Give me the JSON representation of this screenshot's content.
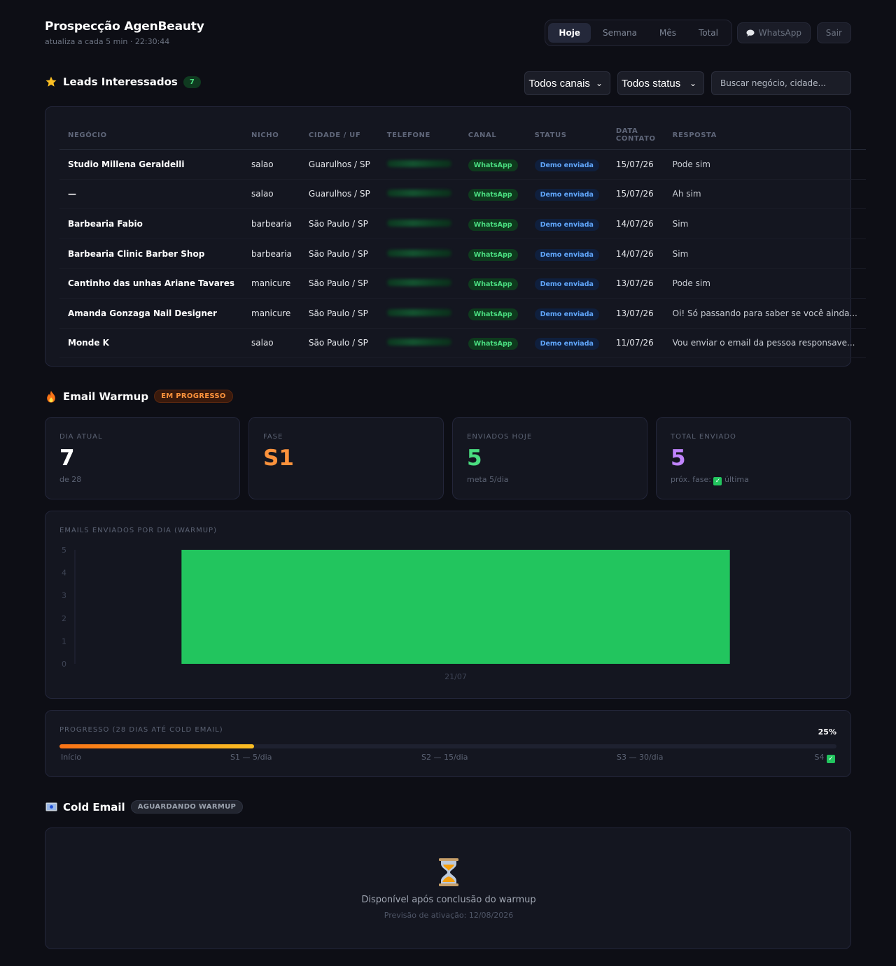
{
  "header": {
    "title": "Prospecção AgenBeauty",
    "subtitle": "atualiza a cada 5 min · 22:30:44",
    "periods": [
      "Hoje",
      "Semana",
      "Mês",
      "Total"
    ],
    "active_period": "Hoje",
    "whatsapp_label": "WhatsApp",
    "logout_label": "Sair"
  },
  "leads": {
    "title": "Leads Interessados",
    "count": "7",
    "filters": {
      "channel": "Todos canais",
      "status": "Todos status",
      "search_placeholder": "Buscar negócio, cidade..."
    },
    "columns": [
      "NEGÓCIO",
      "NICHO",
      "CIDADE / UF",
      "TELEFONE",
      "CANAL",
      "STATUS",
      "DATA CONTATO",
      "RESPOSTA"
    ],
    "rows": [
      {
        "negocio": "Studio Millena Geraldelli",
        "nicho": "salao",
        "cidade": "Guarulhos / SP",
        "canal": "WhatsApp",
        "status": "Demo enviada",
        "data": "15/07/26",
        "resposta": "Pode sim"
      },
      {
        "negocio": "—",
        "nicho": "salao",
        "cidade": "Guarulhos / SP",
        "canal": "WhatsApp",
        "status": "Demo enviada",
        "data": "15/07/26",
        "resposta": "Ah sim"
      },
      {
        "negocio": "Barbearia Fabio",
        "nicho": "barbearia",
        "cidade": "São Paulo / SP",
        "canal": "WhatsApp",
        "status": "Demo enviada",
        "data": "14/07/26",
        "resposta": "Sim"
      },
      {
        "negocio": "Barbearia Clinic Barber Shop",
        "nicho": "barbearia",
        "cidade": "São Paulo / SP",
        "canal": "WhatsApp",
        "status": "Demo enviada",
        "data": "14/07/26",
        "resposta": "Sim"
      },
      {
        "negocio": "Cantinho das unhas Ariane Tavares",
        "nicho": "manicure",
        "cidade": "São Paulo / SP",
        "canal": "WhatsApp",
        "status": "Demo enviada",
        "data": "13/07/26",
        "resposta": "Pode sim"
      },
      {
        "negocio": "Amanda Gonzaga Nail Designer",
        "nicho": "manicure",
        "cidade": "São Paulo / SP",
        "canal": "WhatsApp",
        "status": "Demo enviada",
        "data": "13/07/26",
        "resposta": "Oi! Só passando para saber se você ainda..."
      },
      {
        "negocio": "Monde K",
        "nicho": "salao",
        "cidade": "São Paulo / SP",
        "canal": "WhatsApp",
        "status": "Demo enviada",
        "data": "11/07/26",
        "resposta": "Vou enviar o email da pessoa responsave..."
      }
    ]
  },
  "warmup": {
    "title": "Email Warmup",
    "badge": "EM PROGRESSO",
    "stats": [
      {
        "label": "DIA ATUAL",
        "value": "7",
        "sub": "de 28",
        "color": "#ffffff"
      },
      {
        "label": "FASE",
        "value": "S1",
        "sub": "",
        "color": "#fb923c"
      },
      {
        "label": "ENVIADOS HOJE",
        "value": "5",
        "sub": "meta 5/dia",
        "color": "#4ade80"
      },
      {
        "label": "TOTAL ENVIADO",
        "value": "5",
        "sub_prefix": "próx. fase:",
        "sub_suffix": "última",
        "color": "#c084fc"
      }
    ],
    "chart_title": "EMAILS ENVIADOS POR DIA (WARMUP)",
    "progress": {
      "title": "PROGRESSO (28 DIAS ATÉ COLD EMAIL)",
      "percent_label": "25%",
      "fraction": 0.25,
      "markers": [
        "Início",
        "S1 — 5/dia",
        "S2 — 15/dia",
        "S3 — 30/dia",
        "S4"
      ]
    }
  },
  "chart_data": {
    "type": "bar",
    "categories": [
      "21/07"
    ],
    "values": [
      5
    ],
    "title": "EMAILS ENVIADOS POR DIA (WARMUP)",
    "xlabel": "",
    "ylabel": "",
    "ylim": [
      0,
      5
    ],
    "yticks": [
      0,
      1,
      2,
      3,
      4,
      5
    ],
    "bar_color": "#22c55e",
    "grid": false
  },
  "cold_email": {
    "title": "Cold Email",
    "badge": "AGUARDANDO WARMUP",
    "message": "Disponível após conclusão do warmup",
    "sub": "Previsão de ativação: 12/08/2026"
  },
  "colors": {
    "background": "#0d0e15",
    "card": "#141620",
    "accent_green": "#22c55e",
    "accent_orange": "#fb923c",
    "accent_purple": "#c084fc",
    "accent_blue": "#60a5fa"
  },
  "icons": {
    "leads": "star-icon",
    "warmup": "fire-icon",
    "cold_email": "envelope-icon",
    "whatsapp": "chat-bubble-icon",
    "cold_waiting": "hourglass-icon",
    "check": "check-icon"
  }
}
